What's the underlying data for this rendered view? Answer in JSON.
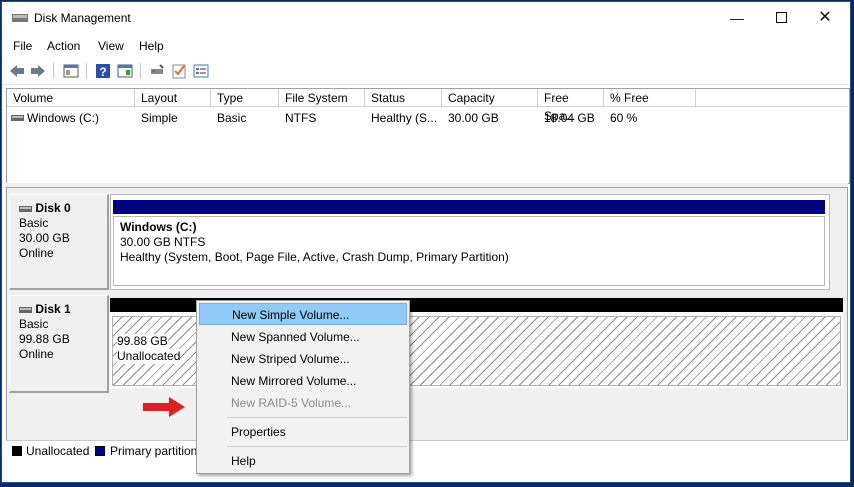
{
  "window": {
    "title": "Disk Management"
  },
  "menubar": [
    "File",
    "Action",
    "View",
    "Help"
  ],
  "volume_list": {
    "columns": [
      "Volume",
      "Layout",
      "Type",
      "File System",
      "Status",
      "Capacity",
      "Free Spa...",
      "% Free"
    ],
    "rows": [
      {
        "volume": "Windows (C:)",
        "layout": "Simple",
        "type": "Basic",
        "fs": "NTFS",
        "status": "Healthy (S...",
        "capacity": "30.00 GB",
        "free": "18.04 GB",
        "pct": "60 %"
      }
    ]
  },
  "disks": [
    {
      "name": "Disk 0",
      "kind": "Basic",
      "size": "30.00 GB",
      "state": "Online",
      "partition": {
        "title": "Windows  (C:)",
        "size_fs": "30.00 GB NTFS",
        "status": "Healthy (System, Boot, Page File, Active, Crash Dump, Primary Partition)"
      },
      "bar_color": "#000080"
    },
    {
      "name": "Disk 1",
      "kind": "Basic",
      "size": "99.88 GB",
      "state": "Online",
      "partition": {
        "size": "99.88 GB",
        "label": "Unallocated"
      },
      "bar_color": "#000000"
    }
  ],
  "legend": [
    {
      "label": "Unallocated",
      "color": "#000000"
    },
    {
      "label": "Primary partition",
      "color": "#000080"
    }
  ],
  "context_menu": {
    "items": [
      {
        "label": "New Simple Volume...",
        "highlighted": true,
        "disabled": false
      },
      {
        "label": "New Spanned Volume...",
        "highlighted": false,
        "disabled": false
      },
      {
        "label": "New Striped Volume...",
        "highlighted": false,
        "disabled": false
      },
      {
        "label": "New Mirrored Volume...",
        "highlighted": false,
        "disabled": false
      },
      {
        "label": "New RAID-5 Volume...",
        "highlighted": false,
        "disabled": true
      },
      {
        "label": "Properties",
        "highlighted": false,
        "disabled": false
      },
      {
        "label": "Help",
        "highlighted": false,
        "disabled": false
      }
    ]
  },
  "annotation": {
    "arrow_color": "#e02020",
    "icon": "red-arrow-icon"
  }
}
